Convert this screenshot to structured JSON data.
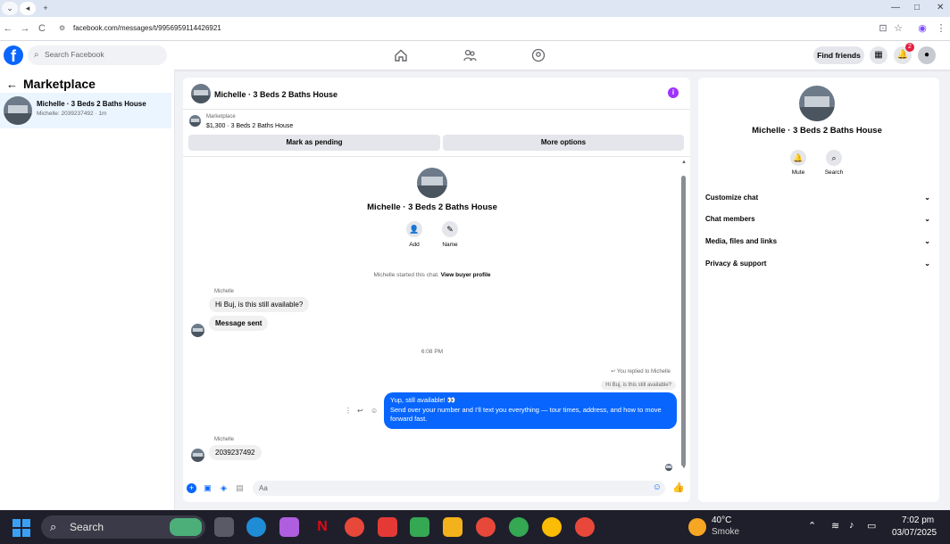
{
  "browser": {
    "url": "facebook.com/messages/t/9956959114426921",
    "nav_back": "←",
    "nav_forward": "→",
    "nav_reload": "C",
    "new_tab": "+",
    "win_min": "—",
    "win_max": "□",
    "win_close": "✕"
  },
  "fb_header": {
    "logo": "f",
    "search_placeholder": "Search Facebook",
    "find_friends": "Find friends",
    "notifications_count": "2"
  },
  "sidebar": {
    "title": "Marketplace",
    "conversation": {
      "name": "Michelle · 3 Beds 2 Baths House",
      "subtitle": "Michelle: 2039237492 · 1m"
    }
  },
  "chat": {
    "header_title": "Michelle · 3 Beds 2 Baths House",
    "marketplace_label": "Marketplace",
    "listing": "$1,300 · 3 Beds 2 Baths House",
    "mark_pending": "Mark as pending",
    "more_options": "More options",
    "profile_name": "Michelle · 3 Beds 2 Baths House",
    "add_label": "Add",
    "name_label": "Name",
    "started_text": "Michelle started this chat.",
    "view_profile": "View buyer profile",
    "sender1": "Michelle",
    "msg1": "Hi Buj, is this still available?",
    "msg2": "Message sent",
    "timestamp": "6:08 PM",
    "reply_note": "You replied to Michelle",
    "reply_quote": "Hi Buj, is this still available?",
    "out_line1": "Yup, still available! 👀",
    "out_line2": "Send over your number and I'll text you everything — tour times, address, and how to move forward fast.",
    "sender2": "Michelle",
    "msg3": "2039237492",
    "composer_placeholder": "Aa"
  },
  "right_panel": {
    "name": "Michelle · 3 Beds 2 Baths House",
    "mute_label": "Mute",
    "search_label": "Search",
    "sections": [
      "Customize chat",
      "Chat members",
      "Media, files and links",
      "Privacy & support"
    ]
  },
  "taskbar": {
    "search_text": "Search",
    "temperature": "40°C",
    "weather": "Smoke",
    "time": "7:02 pm",
    "date": "03/07/2025"
  },
  "colors": {
    "fb_blue": "#0866ff",
    "info_purple": "#a033ff",
    "badge_red": "#e41e3f"
  }
}
